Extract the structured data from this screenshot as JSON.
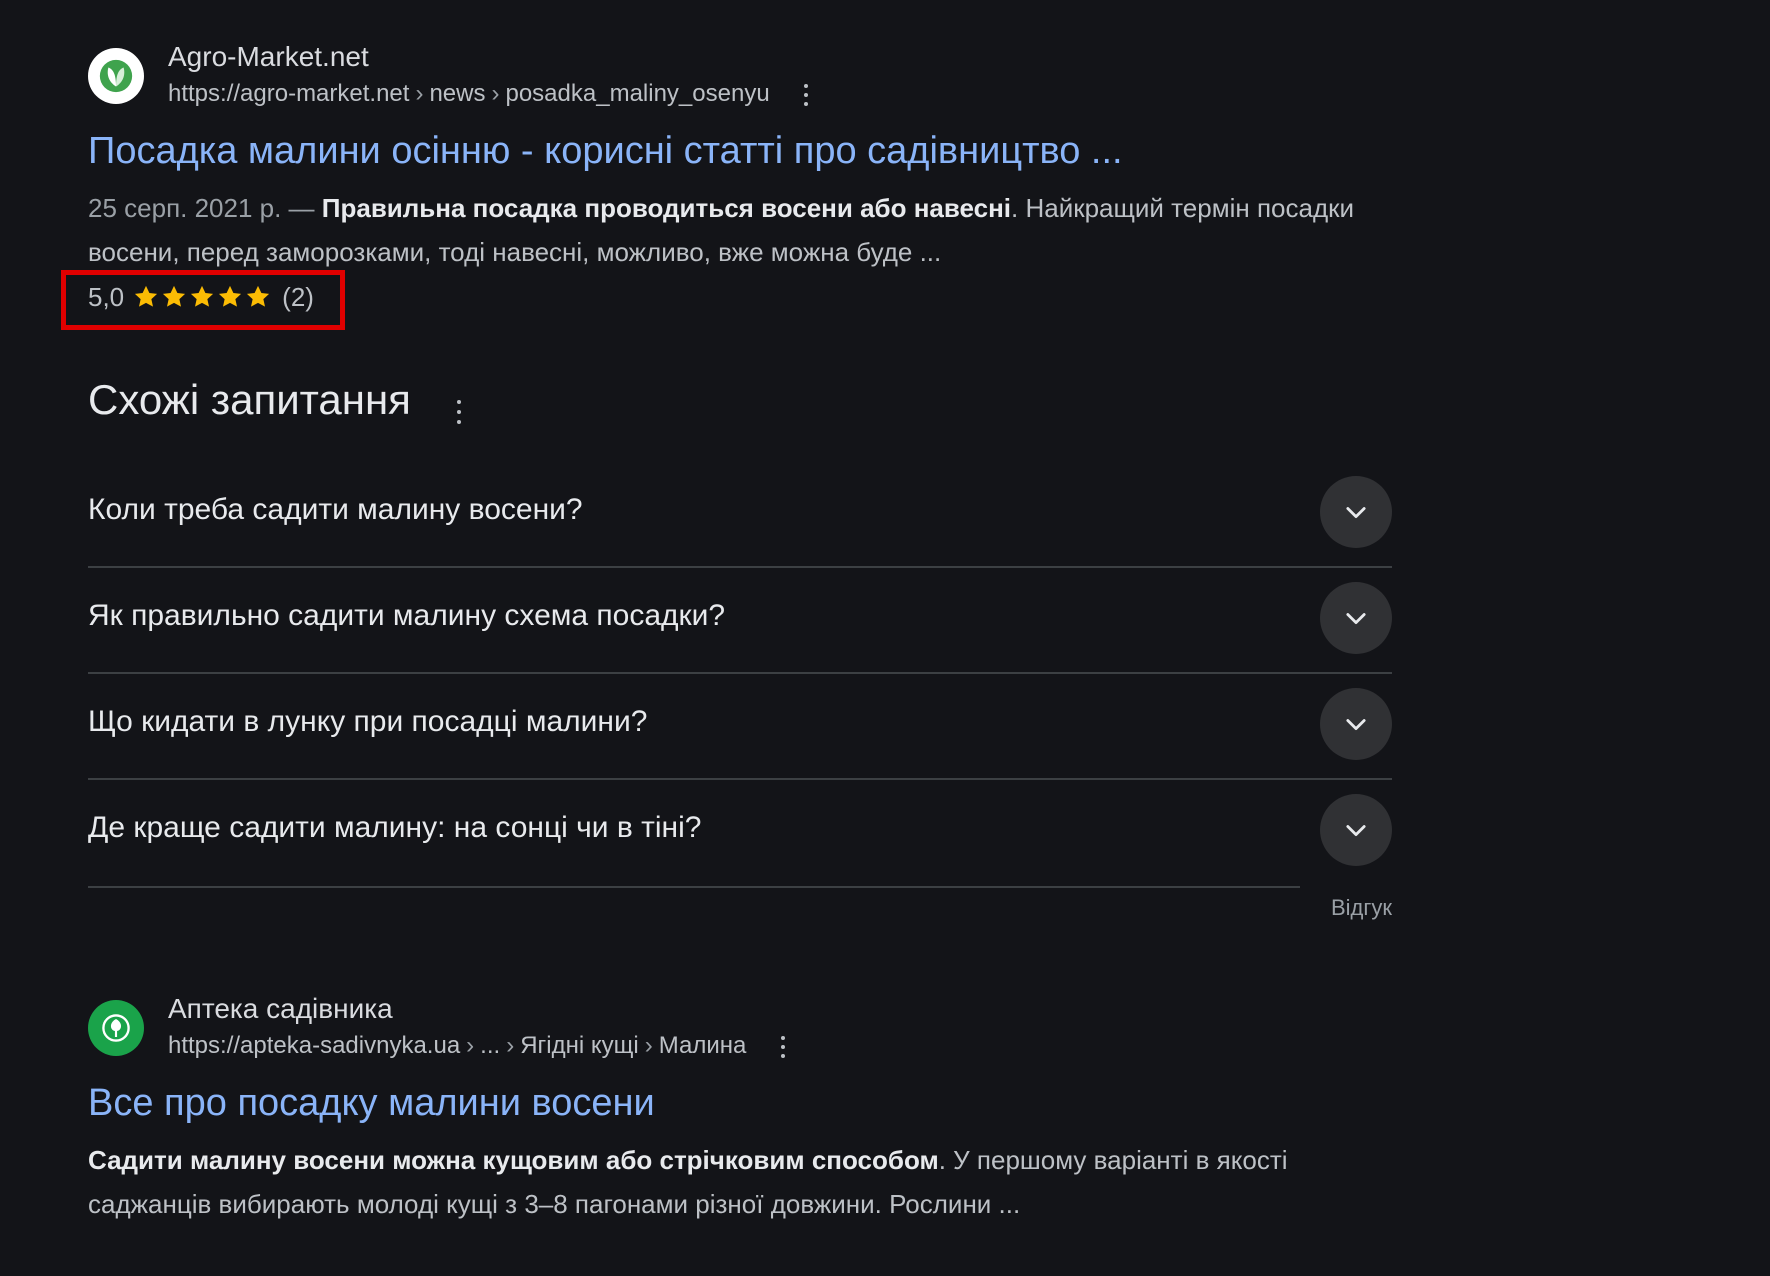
{
  "results": [
    {
      "site_name": "Agro-Market.net",
      "url_parts": [
        "https://agro-market.net",
        "news",
        "posadka_maliny_osenyu"
      ],
      "title": "Посадка малини осінню - корисні статті про садівництво ...",
      "date": "25 серп. 2021 р. — ",
      "snippet_bold": "Правильна посадка проводиться восени або навесні",
      "snippet_rest": ". Найкращий термін посадки восени, перед заморозками, тоді навесні, можливо, вже можна буде ...",
      "rating_value": "5,0",
      "rating_stars": 5,
      "rating_count": "(2)",
      "favicon": "leaf-icon"
    },
    {
      "site_name": "Аптека садівника",
      "url_parts": [
        "https://apteka-sadivnyka.ua",
        "...",
        "Ягідні кущі",
        "Малина"
      ],
      "title": "Все про посадку малини восени",
      "snippet_bold": "Садити малину восени можна кущовим або стрічковим способом",
      "snippet_rest": ". У першому варіанті в якості саджанців вибирають молоді кущі з 3–8 пагонами різної довжини. Рослини ...",
      "favicon": "tree-icon"
    }
  ],
  "related": {
    "title": "Схожі запитання",
    "questions": [
      "Коли треба садити малину восени?",
      "Як правильно садити малину схема посадки?",
      "Що кидати в лунку при посадці малини?",
      "Де краще садити малину: на сонці чи в тіні?"
    ],
    "feedback": "Відгук"
  },
  "colors": {
    "background": "#131418",
    "link": "#8ab4f8",
    "highlight_box": "#e00000",
    "star": "#fbbc04"
  }
}
